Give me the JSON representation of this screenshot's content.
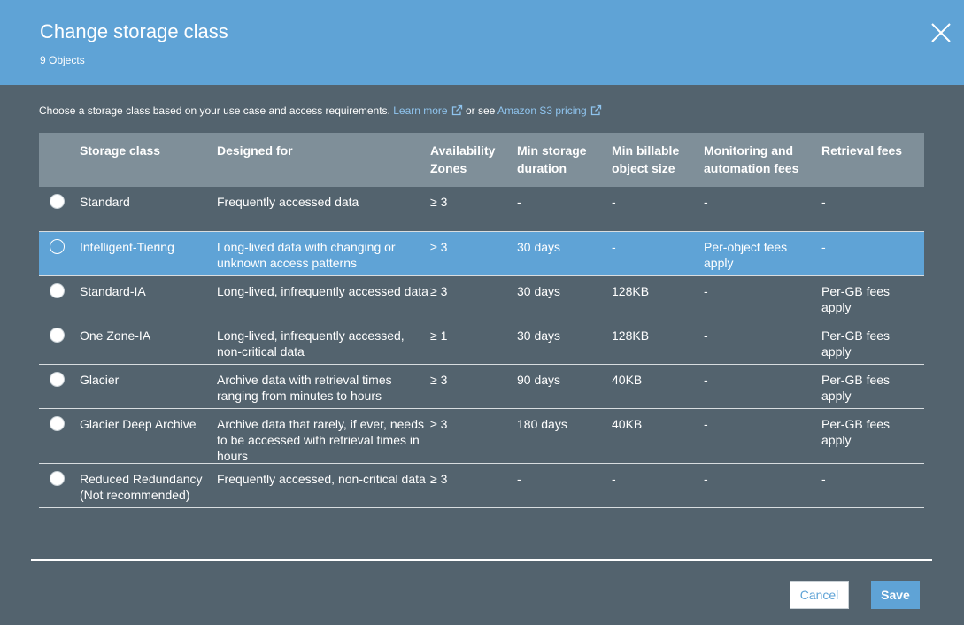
{
  "header": {
    "title": "Change storage class",
    "subtitle": "9 Objects"
  },
  "intro": {
    "text": "Choose a storage class based on your use case and access requirements.",
    "learn_more": "Learn more",
    "or_see": "or see",
    "pricing": "Amazon S3 pricing"
  },
  "columns": {
    "storage_class": "Storage class",
    "designed_for": "Designed for",
    "az_1": "Availability",
    "az_2": "Zones",
    "dur_1": "Min storage",
    "dur_2": "duration",
    "size_1": "Min billable",
    "size_2": "object size",
    "mon_1": "Monitoring and",
    "mon_2": "automation fees",
    "retrieval": "Retrieval fees"
  },
  "rows": [
    {
      "name": "Standard",
      "designed": "Frequently accessed data",
      "az": "≥ 3",
      "duration": "-",
      "size": "-",
      "monitoring": "-",
      "retrieval": "-",
      "selected": false
    },
    {
      "name": "Intelligent-Tiering",
      "designed": "Long-lived data with changing or unknown access patterns",
      "az": "≥ 3",
      "duration": "30 days",
      "size": "-",
      "monitoring": "Per-object fees apply",
      "retrieval": "-",
      "selected": true
    },
    {
      "name": "Standard-IA",
      "designed": "Long-lived, infrequently accessed data",
      "az": "≥ 3",
      "duration": "30 days",
      "size": "128KB",
      "monitoring": "-",
      "retrieval": "Per-GB fees apply",
      "selected": false
    },
    {
      "name": "One Zone-IA",
      "designed": "Long-lived, infrequently accessed, non-critical data",
      "az": "≥ 1",
      "duration": "30 days",
      "size": "128KB",
      "monitoring": "-",
      "retrieval": "Per-GB fees apply",
      "selected": false
    },
    {
      "name": "Glacier",
      "designed": "Archive data with retrieval times ranging from minutes to hours",
      "az": "≥ 3",
      "duration": "90 days",
      "size": "40KB",
      "monitoring": "-",
      "retrieval": "Per-GB fees apply",
      "selected": false
    },
    {
      "name": "Glacier Deep Archive",
      "designed": "Archive data that rarely, if ever, needs to be accessed with retrieval times in hours",
      "az": "≥ 3",
      "duration": "180 days",
      "size": "40KB",
      "monitoring": "-",
      "retrieval": "Per-GB fees apply",
      "selected": false
    },
    {
      "name": "Reduced Redundancy (Not recommended)",
      "designed": "Frequently accessed, non-critical data",
      "az": "≥ 3",
      "duration": "-",
      "size": "-",
      "monitoring": "-",
      "retrieval": "-",
      "selected": false
    }
  ],
  "footer": {
    "cancel": "Cancel",
    "save": "Save"
  },
  "colors": {
    "header_bg": "#5fa3d6",
    "body_bg": "#53636e",
    "table_head_bg": "#7f8f99",
    "selected_row_bg": "#5fa3d6",
    "link": "#8fc4ee"
  },
  "icons": {
    "close": "close-icon",
    "external": "external-link-icon",
    "radio": "radio-button"
  }
}
